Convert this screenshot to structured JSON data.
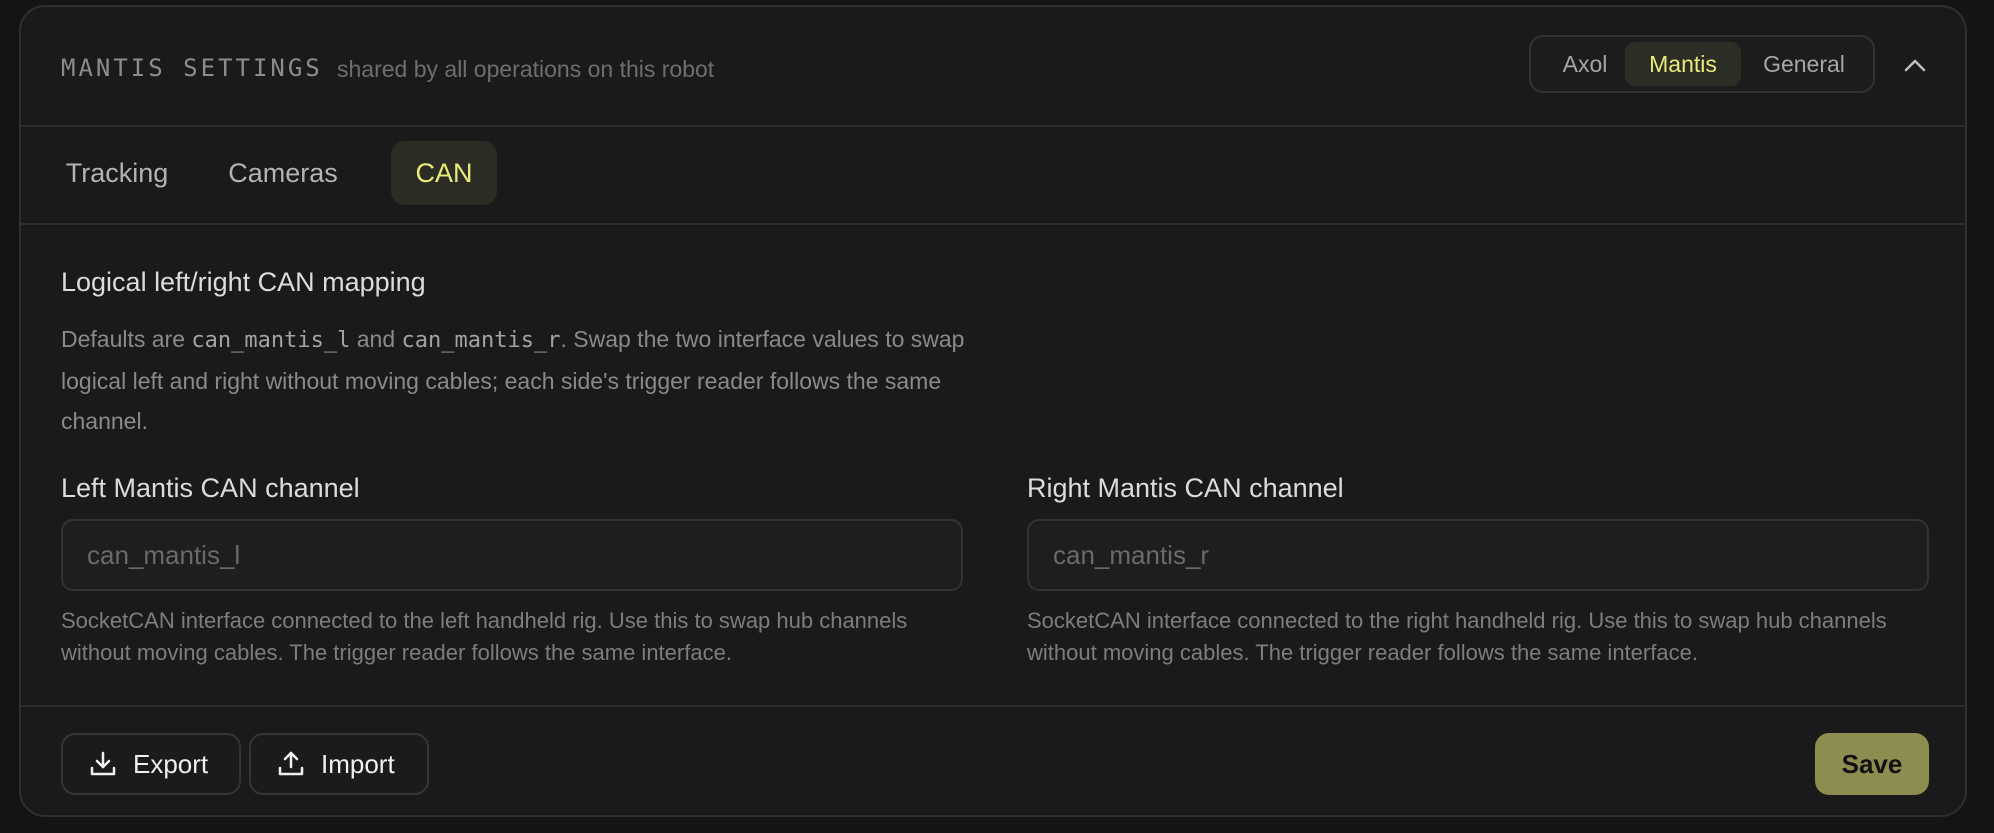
{
  "header": {
    "title": "MANTIS SETTINGS",
    "subtitle": "shared by all operations on this robot",
    "segments": [
      {
        "label": "Axol",
        "active": false
      },
      {
        "label": "Mantis",
        "active": true
      },
      {
        "label": "General",
        "active": false
      }
    ]
  },
  "tabs": [
    {
      "label": "Tracking",
      "active": false
    },
    {
      "label": "Cameras",
      "active": false
    },
    {
      "label": "CAN",
      "active": true
    }
  ],
  "section": {
    "title": "Logical left/right CAN mapping",
    "desc_part1": "Defaults are ",
    "desc_code1": "can_mantis_l",
    "desc_part2": " and ",
    "desc_code2": "can_mantis_r",
    "desc_part3": ". Swap the two interface values to swap logical left and right without moving cables; each side's trigger reader follows the same channel."
  },
  "fields": {
    "left": {
      "label": "Left Mantis CAN channel",
      "value": "",
      "placeholder": "can_mantis_l",
      "help": "SocketCAN interface connected to the left handheld rig. Use this to swap hub channels without moving cables. The trigger reader follows the same interface."
    },
    "right": {
      "label": "Right Mantis CAN channel",
      "value": "",
      "placeholder": "can_mantis_r",
      "help": "SocketCAN interface connected to the right handheld rig. Use this to swap hub channels without moving cables. The trigger reader follows the same interface."
    }
  },
  "footer": {
    "export_label": "Export",
    "import_label": "Import",
    "save_label": "Save"
  },
  "colors": {
    "accent": "#e8ea7a",
    "save_bg": "#8d8d52",
    "panel_bg": "#1a1a1a",
    "page_bg": "#141414"
  },
  "icons": {
    "collapse": "chevron-up-icon",
    "export": "download-icon",
    "import": "upload-icon"
  }
}
